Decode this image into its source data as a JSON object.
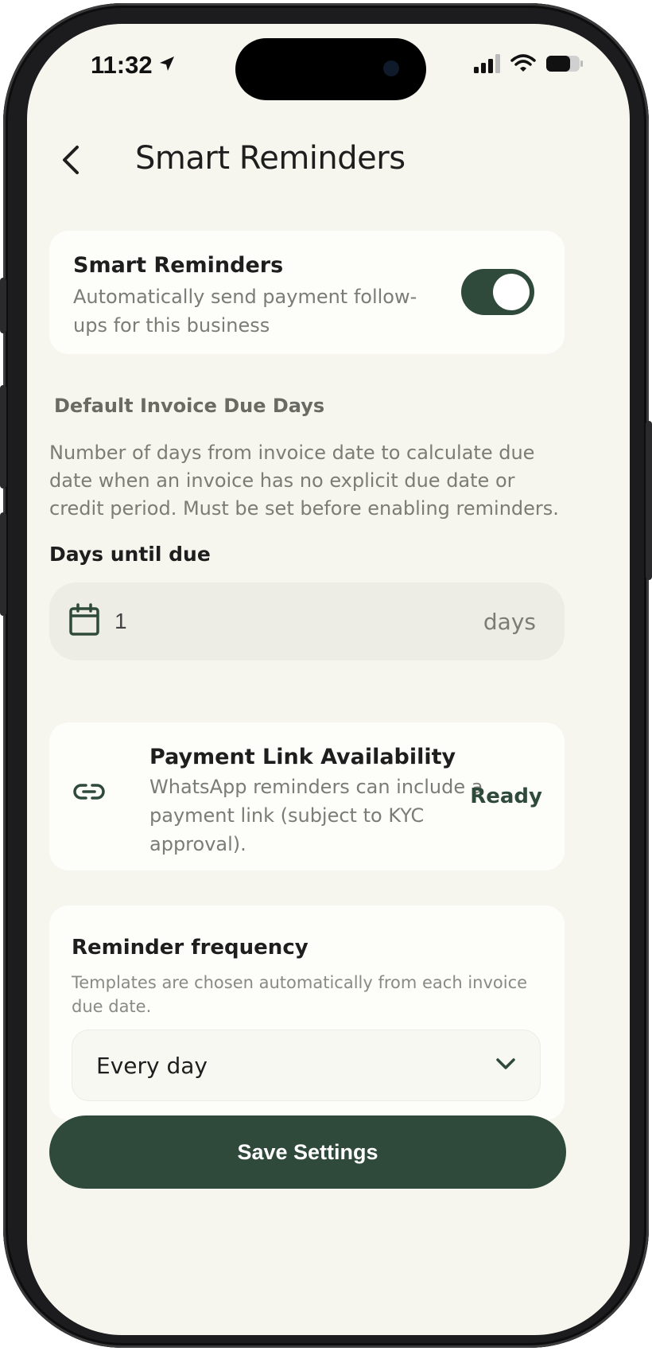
{
  "status_bar": {
    "time": "11:32"
  },
  "header": {
    "title": "Smart Reminders"
  },
  "smart_reminders": {
    "title": "Smart Reminders",
    "description": "Automatically send payment follow-ups for this business",
    "enabled": true
  },
  "due_days": {
    "section_label": "Default Invoice Due Days",
    "description": "Number of days from invoice date to calculate due date when an invoice has no explicit due date or credit period. Must be set before enabling reminders.",
    "field_label": "Days until due",
    "value": "1",
    "unit": "days"
  },
  "payment_link": {
    "title": "Payment Link Availability",
    "description": "WhatsApp reminders can include a payment link (subject to KYC approval).",
    "status": "Ready"
  },
  "frequency": {
    "title": "Reminder frequency",
    "description": "Templates are chosen automatically from each invoice due date.",
    "selected": "Every day"
  },
  "actions": {
    "save_label": "Save Settings"
  },
  "colors": {
    "accent": "#2f4a3b",
    "background": "#f6f6ef",
    "card": "#fdfdf9"
  },
  "icons": {
    "back": "chevron-left-icon",
    "calendar": "calendar-icon",
    "link": "link-icon",
    "dropdown": "chevron-down-icon",
    "location": "location-arrow-icon",
    "signal": "signal-icon",
    "wifi": "wifi-icon",
    "battery": "battery-icon"
  }
}
